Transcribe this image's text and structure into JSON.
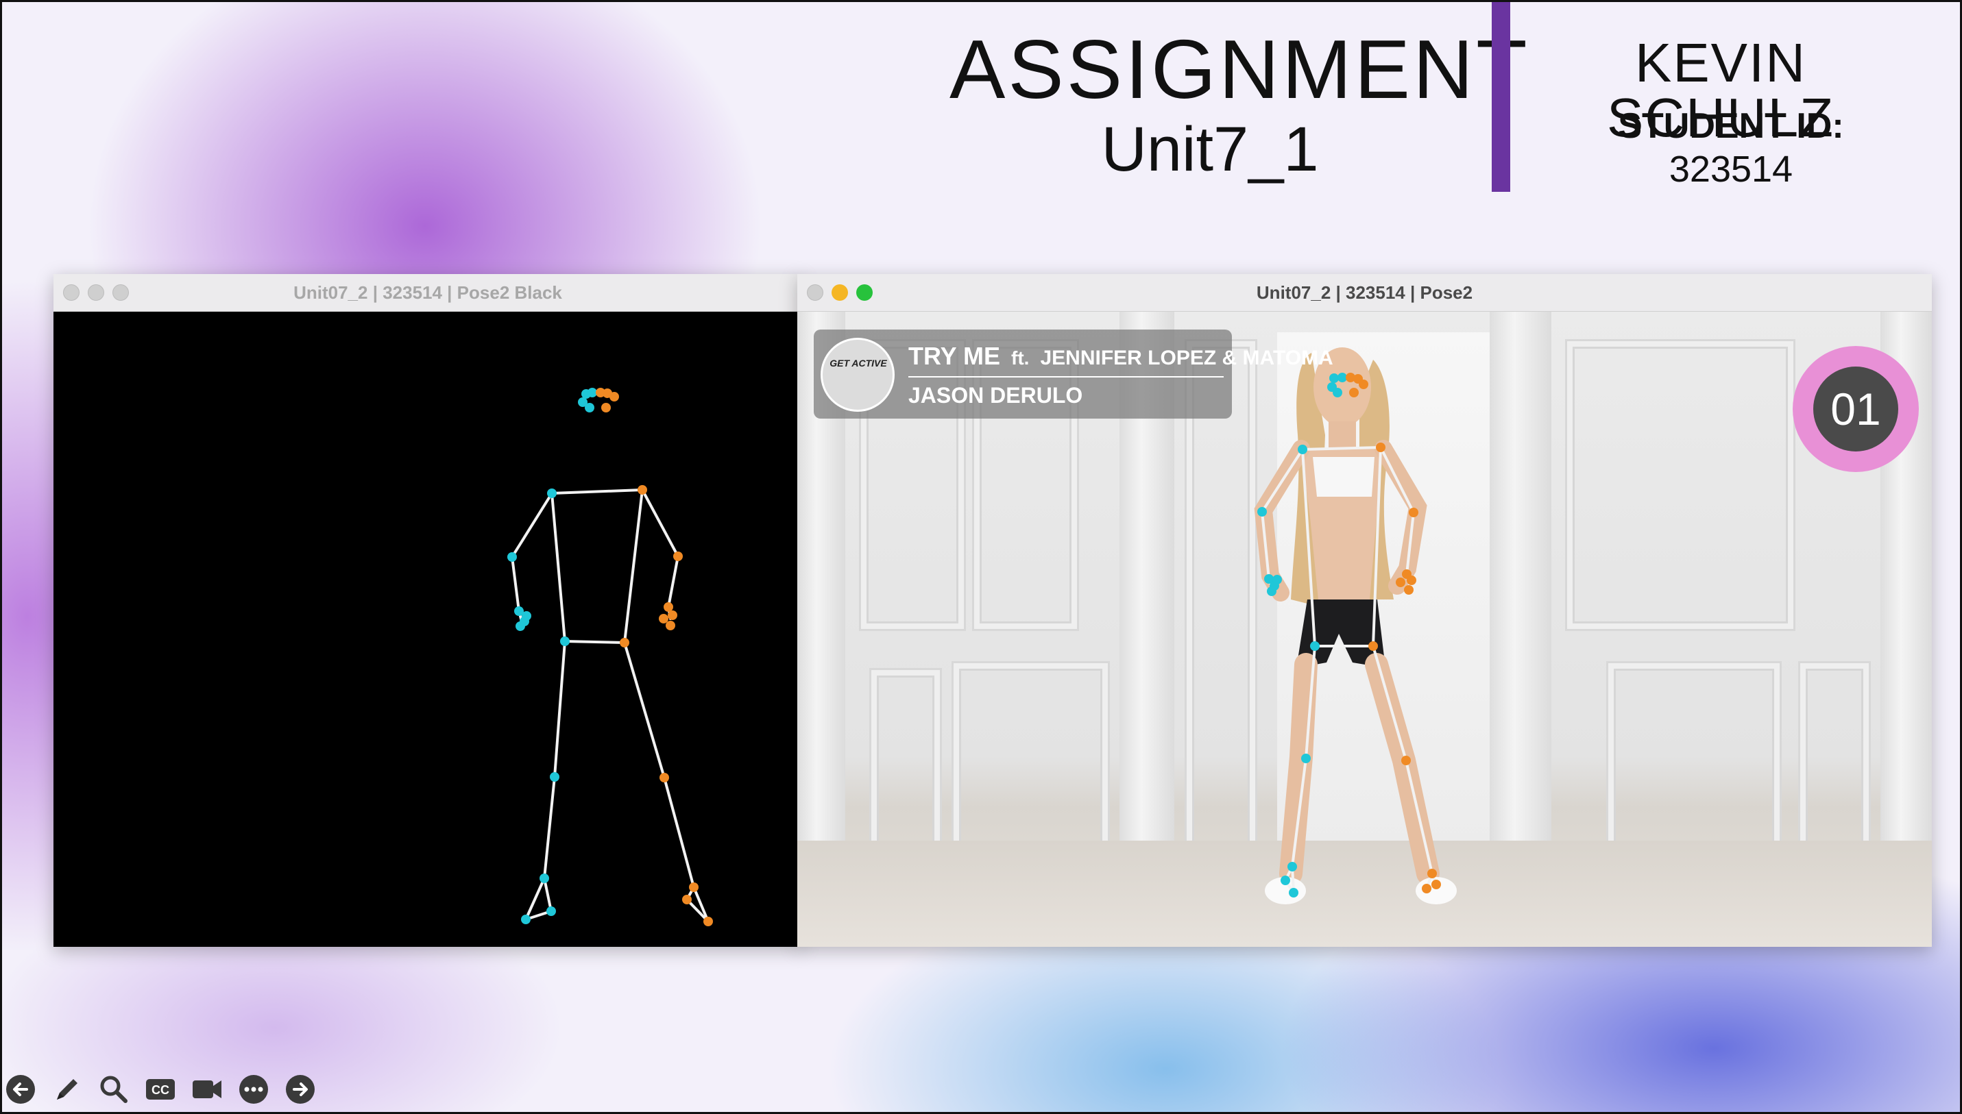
{
  "header": {
    "title": "ASSIGNMENT",
    "subtitle": "Unit7_1",
    "student_name": "KEVIN SCHULZ",
    "student_id_label": "STUDENT ID:",
    "student_id": "323514"
  },
  "window_left": {
    "title": "Unit07_2 | 323514 | Pose2 Black"
  },
  "window_right": {
    "title": "Unit07_2 | 323514 | Pose2",
    "song_title": "TRY ME",
    "song_ft": "ft.",
    "song_featuring": "JENNIFER LOPEZ & MATOMA",
    "artist": "JASON DERULO",
    "thumb_badge": "GET ACTIVE",
    "counter": "01"
  },
  "toolbar": {
    "icons": [
      "back-arrow-icon",
      "pen-icon",
      "magnifier-icon",
      "closed-caption-icon",
      "video-camera-icon",
      "more-options-icon",
      "forward-arrow-icon"
    ]
  },
  "colors": {
    "accent_bar": "#6a34a0",
    "left_keypoint": "#1fc7d8",
    "right_keypoint": "#f08a24",
    "skeleton_line": "#f2f2f2",
    "counter_ring": "#e890d6"
  }
}
